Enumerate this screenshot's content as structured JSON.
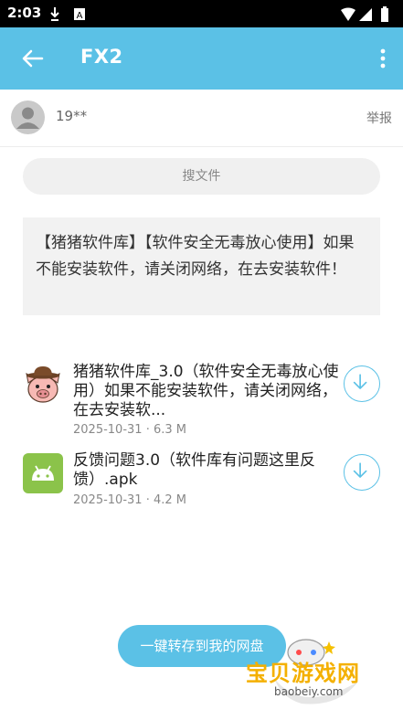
{
  "status": {
    "time": "2:03"
  },
  "appbar": {
    "title": "FX2"
  },
  "user": {
    "name": "19**",
    "report_label": "举报"
  },
  "search": {
    "placeholder": "搜文件"
  },
  "notice": {
    "text": "【猪猪软件库】【软件安全无毒放心使用】如果不能安装软件，请关闭网络，在去安装软件！"
  },
  "files": [
    {
      "name": "猪猪软件库_3.0（软件安全无毒放心使用）如果不能安装软件，请关闭网络，在去安装软...",
      "date": "2025-10-31",
      "size": "6.3 M",
      "icon": "pig-icon"
    },
    {
      "name": "反馈问题3.0（软件库有问题这里反馈）.apk",
      "date": "2025-10-31",
      "size": "4.2 M",
      "icon": "android-icon"
    }
  ],
  "actions": {
    "save_label": "一键转存到我的网盘"
  },
  "watermark": {
    "title": "宝贝游戏网",
    "url": "baobeiy.com"
  },
  "colors": {
    "accent": "#5bc1e6"
  }
}
